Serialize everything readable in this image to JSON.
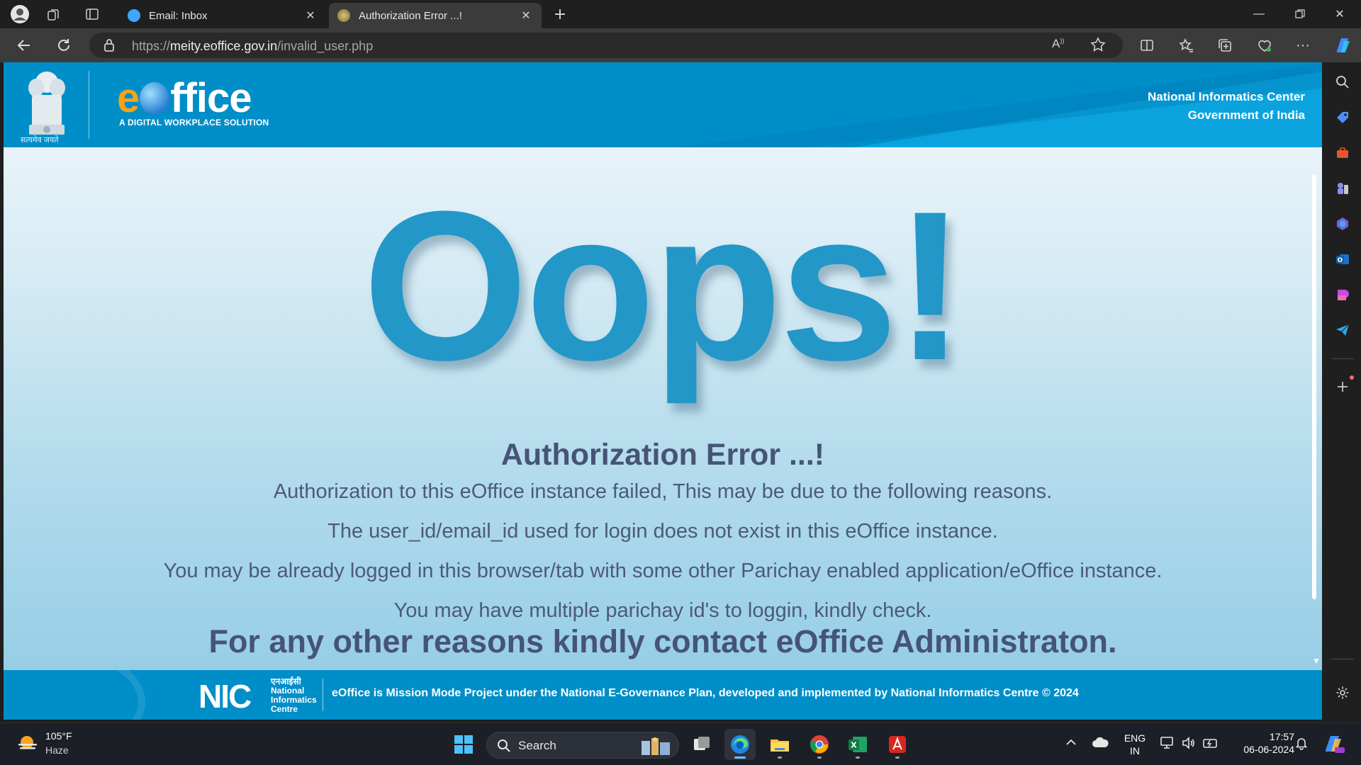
{
  "browser": {
    "tabs": [
      {
        "title": "Email: Inbox"
      },
      {
        "title": "Authorization Error ...!"
      }
    ],
    "address": {
      "scheme": "https://",
      "host": "meity.eoffice.gov.in",
      "path": "/invalid_user.php"
    }
  },
  "page": {
    "header": {
      "emblem_caption": "सत्यमेव जयते",
      "logo_e": "e",
      "logo_rest": "ffice",
      "tagline": "A DIGITAL WORKPLACE SOLUTION",
      "org_line1": "National Informatics Center",
      "org_line2": "Government of India"
    },
    "oops": "Oops!",
    "error_title": "Authorization Error ...!",
    "messages": [
      "Authorization to this eOffice instance failed, This may be due to the following reasons.",
      "The user_id/email_id used for login does not exist in this eOffice instance.",
      "You may be already logged in this browser/tab with some other Parichay enabled application/eOffice instance.",
      "You may have multiple parichay id's to loggin, kindly check."
    ],
    "contact": "For any other reasons kindly contact eOffice Administraton.",
    "footer": {
      "nic_logo": "NIC",
      "nic_hindi": "एनआईसी",
      "nic_sub1": "National",
      "nic_sub2": "Informatics",
      "nic_sub3": "Centre",
      "text": "eOffice is Mission Mode Project under the National E-Governance Plan, developed and implemented by National Informatics Centre © 2024"
    }
  },
  "taskbar": {
    "weather_temp": "105°F",
    "weather_cond": "Haze",
    "search_label": "Search",
    "lang_line1": "ENG",
    "lang_line2": "IN",
    "time": "17:57",
    "date": "06-06-2024"
  },
  "colors": {
    "header_blue": "#008ec8",
    "oops_blue": "#2397c8",
    "heading_slate": "#465475",
    "logo_orange": "#f6a21b"
  }
}
